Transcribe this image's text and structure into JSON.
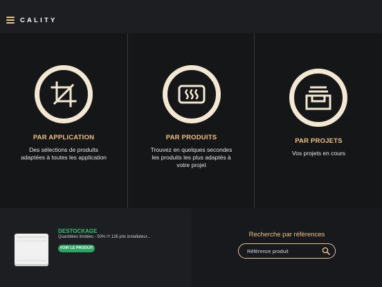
{
  "app": {
    "brand": "CALITY",
    "menu_icon": "hamburger-menu-icon"
  },
  "categories": [
    {
      "title": "PAR APPLICATION",
      "description": "Des sélections de produits adaptées à toutes les application",
      "icon": "crop-icon"
    },
    {
      "title": "PAR PRODUITS",
      "description": "Trouvez en quelques secondes les produits les plus adaptés à votre projet",
      "icon": "heater-icon"
    },
    {
      "title": "PAR PROJETS",
      "description": "Vos projets en cours",
      "icon": "archive-tray-icon"
    }
  ],
  "promo": {
    "title": "DESTOCKAGE",
    "text": "Quantitées limitées - 50% !!! 12€ prix installateur...",
    "button_label": "VOIR LE PRODUIT",
    "image": "radiator-product-image",
    "accent_color": "#2aa563"
  },
  "search": {
    "title": "Recherche par références",
    "placeholder": "Référence produit",
    "icon": "search-icon"
  },
  "colors": {
    "accent": "#f2c37e",
    "ring": "#f4e8d2",
    "background": "#151618"
  }
}
